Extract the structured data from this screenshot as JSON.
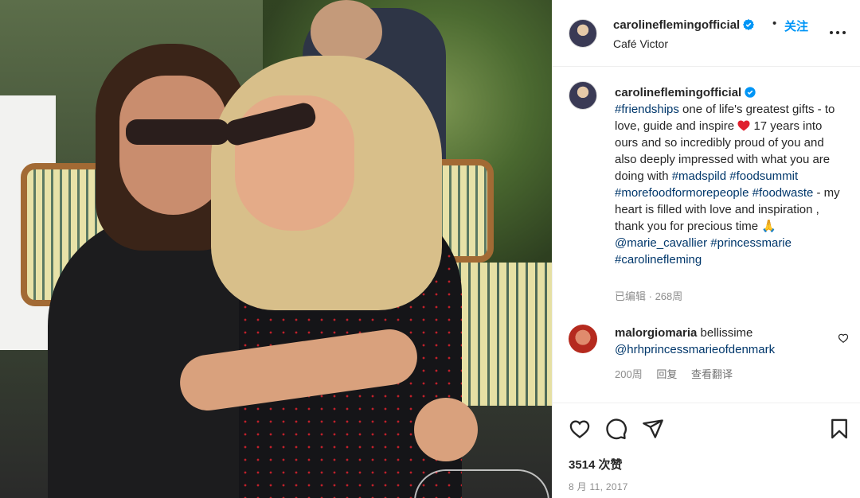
{
  "post": {
    "username": "carolineflemingofficial",
    "verified": true,
    "separator": "•",
    "follow_label": "关注",
    "location": "Café Victor",
    "more_icon": "more-horizontal-icon"
  },
  "caption": {
    "username": "carolineflemingofficial",
    "segments": {
      "t1": "#friendships",
      "t2": " one of life's greatest gifts - to love, guide and inspire ",
      "t3": " 17 years into ours and so incredibly proud of you and also deeply impressed with what you are doing with ",
      "t4": "#madspild",
      "t5": " ",
      "t6": "#foodsummit",
      "t7": " ",
      "t8": "#morefoodformorepeople",
      "t9": " ",
      "t10": "#foodwaste",
      "t11": " - my heart is filled with love and inspiration , thank you for precious time ",
      "t12": "🙏",
      "t13": " ",
      "t14": "@marie_cavallier",
      "t15": " ",
      "t16": "#princessmarie",
      "t17": " ",
      "t18": "#carolinefleming"
    },
    "edited": "已编辑",
    "meta_sep": " · ",
    "age": "268周"
  },
  "comment": {
    "username": "malorgiomaria",
    "text": " bellissime ",
    "mention": "@hrhprincessmarieofdenmark",
    "age": "200周",
    "reply_label": "回复",
    "translate_label": "查看翻译"
  },
  "actions": {
    "likes": "3514 次赞",
    "date": "8 月 11, 2017"
  },
  "colors": {
    "link": "#00376b",
    "follow": "#0095f6",
    "verified": "#0095f6",
    "meta": "#8e8e8e",
    "heart_emoji": "#e0202e"
  }
}
